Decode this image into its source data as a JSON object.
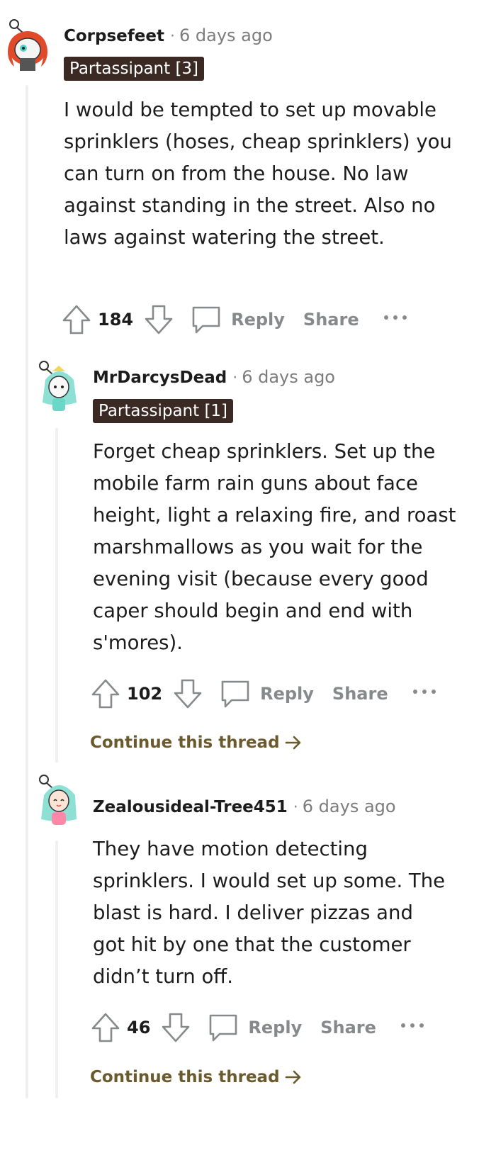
{
  "comments": [
    {
      "username": "Corpsefeet",
      "time": "6 days ago",
      "flair": "Partassipant [3]",
      "body": "I would be tempted to set up movable sprinklers (hoses, cheap sprinklers) you can turn on from the house. No law against standing in the street. Also no laws against watering the street.",
      "votes": "184",
      "reply_label": "Reply",
      "share_label": "Share"
    },
    {
      "username": "MrDarcysDead",
      "time": "6 days ago",
      "flair": "Partassipant [1]",
      "body": "Forget cheap sprinklers. Set up the mobile farm rain guns about face height, light a relaxing fire, and roast marshmallows as you wait for the evening visit (because every good caper should begin and end with s'mores).",
      "votes": "102",
      "reply_label": "Reply",
      "share_label": "Share",
      "continue_label": "Continue this thread"
    },
    {
      "username": "Zealousideal-Tree451",
      "time": "6 days ago",
      "body": "They have motion detecting sprinklers. I would set up some. The blast is hard. I deliver pizzas and got hit by one that the customer didn’t turn off.",
      "votes": "46",
      "reply_label": "Reply",
      "share_label": "Share",
      "continue_label": "Continue this thread"
    }
  ],
  "separator": "·",
  "colors": {
    "flair_bg": "#3b2a24",
    "continue_link": "#6b5a2e",
    "thread_line": "#edeff1",
    "muted": "#878a8c"
  },
  "icons": [
    "upvote-icon",
    "downvote-icon",
    "comment-icon",
    "more-icon",
    "arrow-right-icon"
  ]
}
